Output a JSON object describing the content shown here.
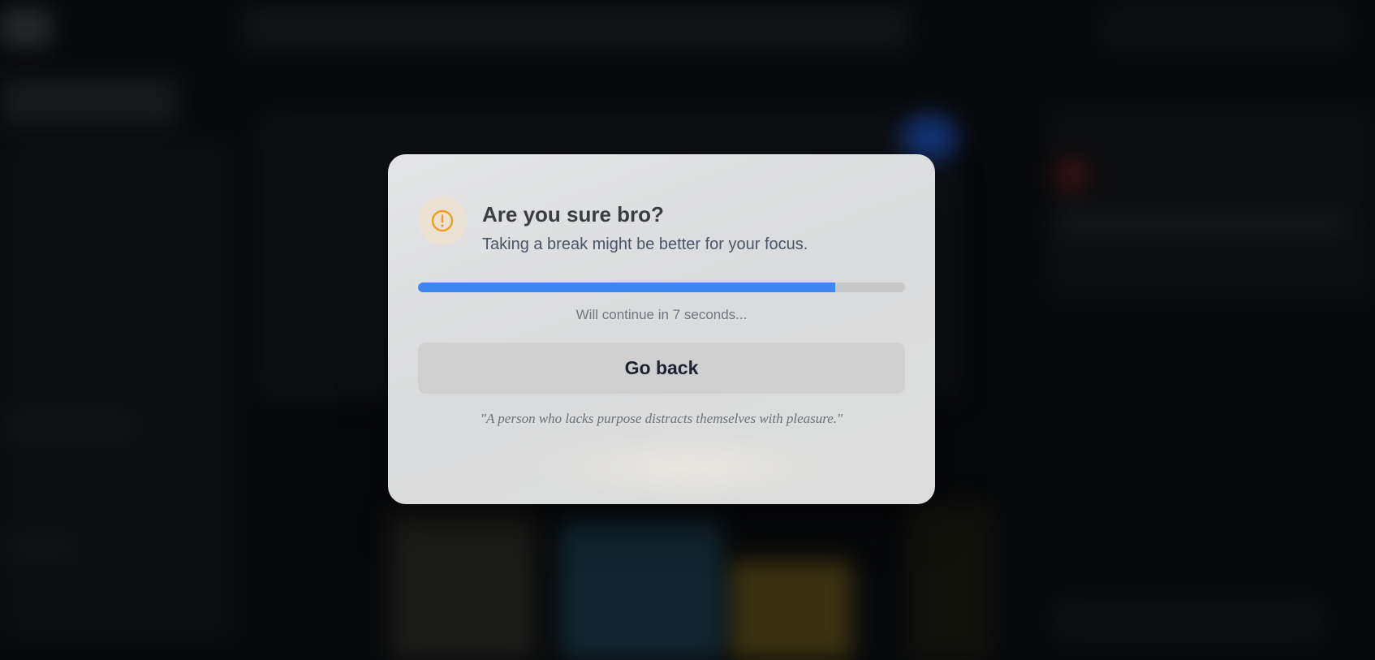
{
  "dialog": {
    "title": "Are you sure bro?",
    "subtitle": "Taking a break might be better for your focus.",
    "progress": 0.857,
    "countdown_text": "Will continue in 7 seconds...",
    "go_back_label": "Go back",
    "quote": "\"A person who lacks purpose distracts themselves with pleasure.\"",
    "icon": "exclamation-circle-icon"
  },
  "colors": {
    "accent": "#3f87f0",
    "warning": "#f0a01e",
    "modal_bg": "#dedfe0"
  }
}
